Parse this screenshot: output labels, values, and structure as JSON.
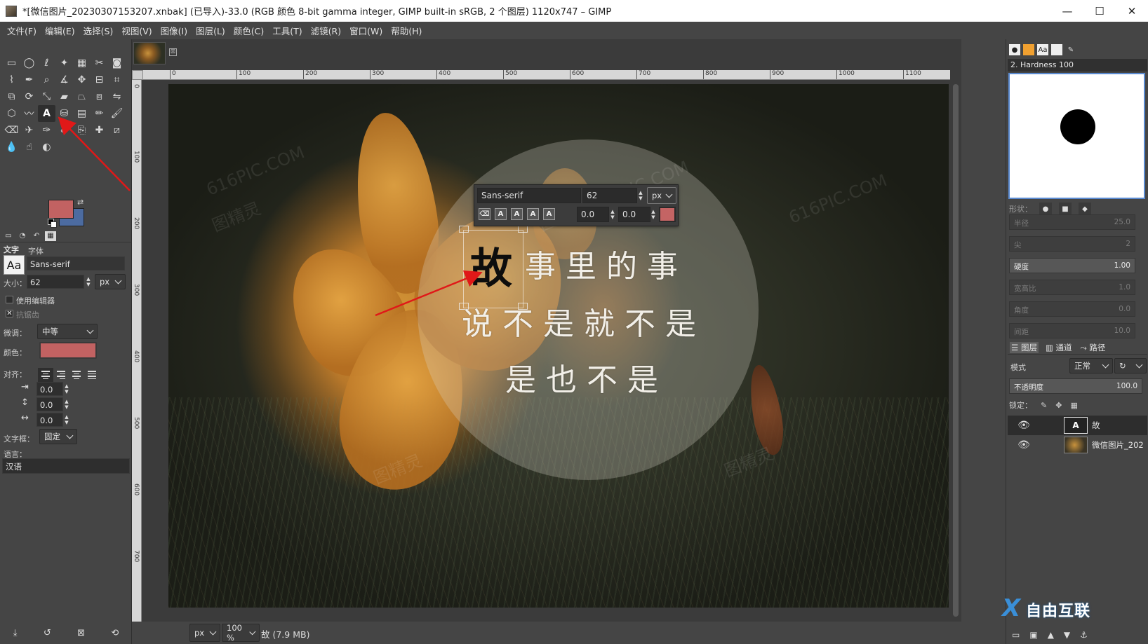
{
  "window": {
    "title": "*[微信图片_20230307153207.xnbak] (已导入)-33.0 (RGB 颜色 8-bit gamma integer, GIMP built-in sRGB, 2 个图层) 1120x747 – GIMP",
    "minimize": "—",
    "maximize": "☐",
    "close": "✕"
  },
  "menu": [
    "文件(F)",
    "编辑(E)",
    "选择(S)",
    "视图(V)",
    "图像(I)",
    "图层(L)",
    "颜色(C)",
    "工具(T)",
    "滤镜(R)",
    "窗口(W)",
    "帮助(H)"
  ],
  "toolbox": {
    "tools": [
      "rect-select-icon",
      "ellipse-select-icon",
      "free-select-icon",
      "fuzzy-select-icon",
      "select-by-color-icon",
      "scissors-icon",
      "foreground-select-icon",
      "paths-icon",
      "color-picker-icon",
      "zoom-icon",
      "measure-icon",
      "move-icon",
      "align-icon",
      "crop-icon",
      "unified-transform-icon",
      "rotate-icon",
      "scale-icon",
      "shear-icon",
      "perspective-icon",
      "3d-transform-icon",
      "flip-icon",
      "cage-icon",
      "warp-icon",
      "text-icon",
      "bucket-fill-icon",
      "gradient-icon",
      "pencil-icon",
      "paintbrush-icon",
      "eraser-icon",
      "airbrush-icon",
      "ink-icon",
      "mypaint-brush-icon",
      "clone-icon",
      "heal-icon",
      "perspective-clone-icon",
      "blur-icon",
      "smudge-icon",
      "dodge-burn-icon"
    ],
    "active_tool": "text-icon",
    "fg_color": "#c26262",
    "bg_color": "#4c6ba0"
  },
  "text_options": {
    "section_title": "文字",
    "font_label": "字体",
    "font_preview": "Aa",
    "font_value": "Sans-serif",
    "size_label": "大小：",
    "size_value": "62",
    "size_unit": "px",
    "use_editor_label": "使用编辑器",
    "antialias_label": "抗锯齿",
    "antialias_mark": "✕",
    "hinting_label": "微调：",
    "hinting_value": "中等",
    "color_label": "颜色：",
    "color_value": "#c26262",
    "justify_label": "对齐：",
    "indent_value": "0.0",
    "line_spacing_value": "0.0",
    "letter_spacing_value": "0.0",
    "box_label": "文字框：",
    "box_value": "固定",
    "language_label": "语言：",
    "language_value": "汉语"
  },
  "canvas": {
    "ruler_h": [
      "0",
      "100",
      "200",
      "300",
      "400",
      "500",
      "600",
      "700",
      "800",
      "900",
      "1000",
      "1100"
    ],
    "ruler_v": [
      "0",
      "100",
      "200",
      "300",
      "400",
      "500",
      "600",
      "700"
    ],
    "tab_close": "⊠",
    "watermarks": [
      "616PIC.COM",
      "图精灵",
      "图精灵 616PIC.COM",
      "616PIC.COM",
      "图精灵",
      "图精灵"
    ],
    "poem": {
      "first_char": "故",
      "line1_rest": "事里的事",
      "line2": "说不是就不是",
      "line3": "是也不是"
    }
  },
  "text_editor": {
    "font": "Sans-serif",
    "size": "62",
    "unit": "px",
    "style_buttons": [
      "⌫",
      "A",
      "A",
      "A",
      "A"
    ],
    "baseline": "0.0",
    "kerning": "0.0",
    "color": "#c46464"
  },
  "status": {
    "unit": "px",
    "zoom": "100 %",
    "info": "故 (7.9 MB)"
  },
  "right_dock": {
    "brush_name": "2. Hardness 100",
    "shape_label": "形状：",
    "sliders": [
      {
        "label": "半径",
        "value": "25.0",
        "active": false
      },
      {
        "label": "尖",
        "value": "2",
        "active": false
      },
      {
        "label": "硬度",
        "value": "1.00",
        "active": true
      },
      {
        "label": "宽高比",
        "value": "1.0",
        "active": false
      },
      {
        "label": "角度",
        "value": "0.0",
        "active": false
      },
      {
        "label": "间距",
        "value": "10.0",
        "active": false
      }
    ],
    "tabs": [
      "图层",
      "通道",
      "路径"
    ],
    "mode_label": "模式",
    "mode_value": "正常",
    "opacity_label": "不透明度",
    "opacity_value": "100.0",
    "lock_label": "锁定：",
    "layers": [
      {
        "name": "故",
        "type": "text",
        "visible": true
      },
      {
        "name": "微信图片_202",
        "type": "image",
        "visible": true
      }
    ]
  },
  "logo": {
    "mark": "X",
    "text": "自由互联"
  }
}
